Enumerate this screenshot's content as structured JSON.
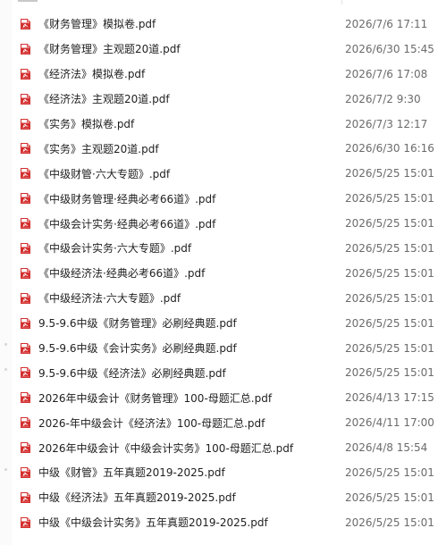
{
  "colors": {
    "pdf_icon_red": "#d32f2f",
    "date_text": "#6b6b6b",
    "name_text": "#1f1f1f"
  },
  "files": [
    {
      "name": "《财务管理》模拟卷.pdf",
      "date": "2026/7/6 17:11",
      "icon": "pdf-icon"
    },
    {
      "name": "《财务管理》主观题20道.pdf",
      "date": "2026/6/30 15:45",
      "icon": "pdf-icon"
    },
    {
      "name": "《经济法》模拟卷.pdf",
      "date": "2026/7/6 17:08",
      "icon": "pdf-icon"
    },
    {
      "name": "《经济法》主观题20道.pdf",
      "date": "2026/7/2 9:30",
      "icon": "pdf-icon"
    },
    {
      "name": "《实务》模拟卷.pdf",
      "date": "2026/7/3 12:17",
      "icon": "pdf-icon"
    },
    {
      "name": "《实务》主观题20道.pdf",
      "date": "2026/6/30 16:16",
      "icon": "pdf-icon"
    },
    {
      "name": "《中级财管·六大专题》.pdf",
      "date": "2026/5/25 15:01",
      "icon": "pdf-icon"
    },
    {
      "name": "《中级财务管理·经典必考66道》.pdf",
      "date": "2026/5/25 15:01",
      "icon": "pdf-icon"
    },
    {
      "name": "《中级会计实务·经典必考66道》.pdf",
      "date": "2026/5/25 15:01",
      "icon": "pdf-icon"
    },
    {
      "name": "《中级会计实务·六大专题》.pdf",
      "date": "2026/5/25 15:01",
      "icon": "pdf-icon"
    },
    {
      "name": "《中级经济法·经典必考66道》.pdf",
      "date": "2026/5/25 15:01",
      "icon": "pdf-icon"
    },
    {
      "name": "《中级经济法·六大专题》.pdf",
      "date": "2026/5/25 15:01",
      "icon": "pdf-icon"
    },
    {
      "name": "9.5-9.6中级《财务管理》必刷经典题.pdf",
      "date": "2026/5/25 15:01",
      "icon": "pdf-icon"
    },
    {
      "name": "9.5-9.6中级《会计实务》必刷经典题.pdf",
      "date": "2026/5/25 15:01",
      "icon": "pdf-icon"
    },
    {
      "name": "9.5-9.6中级《经济法》必刷经典题.pdf",
      "date": "2026/5/25 15:01",
      "icon": "pdf-icon"
    },
    {
      "name": "2026年中级会计《财务管理》100-母题汇总.pdf",
      "date": "2026/4/13 17:15",
      "icon": "pdf-icon"
    },
    {
      "name": "2026-年中级会计《经济法》100-母题汇总.pdf",
      "date": "2026/4/11 17:00",
      "icon": "pdf-icon"
    },
    {
      "name": "2026年中级会计《中级会计实务》100-母题汇总.pdf",
      "date": "2026/4/8 15:54",
      "icon": "pdf-icon"
    },
    {
      "name": "中级《财管》五年真题2019-2025.pdf",
      "date": "2026/5/25 15:01",
      "icon": "pdf-icon"
    },
    {
      "name": "中级《经济法》五年真题2019-2025.pdf",
      "date": "2026/5/25 15:01",
      "icon": "pdf-icon"
    },
    {
      "name": "中级《中级会计实务》五年真题2019-2025.pdf",
      "date": "2026/5/25 15:01",
      "icon": "pdf-icon"
    }
  ]
}
